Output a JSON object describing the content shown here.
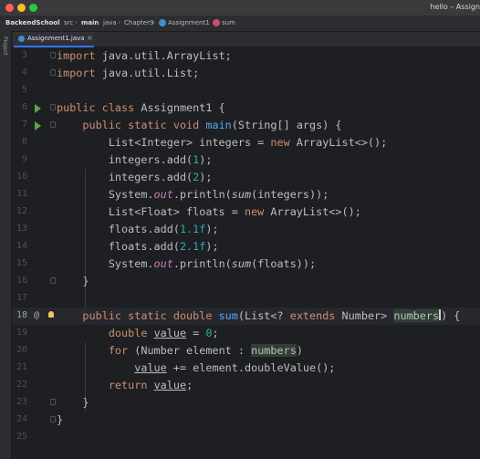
{
  "window": {
    "title": "hello – Assign"
  },
  "breadcrumb": [
    "BackendSchool",
    "src",
    "main",
    "java",
    "Chapter9",
    "Assignment1",
    "sum"
  ],
  "tab": {
    "label": "Assignment1.java",
    "close": "×"
  },
  "side_strip": {
    "label": "Project"
  },
  "editor": {
    "current_line": 18,
    "lines": [
      {
        "n": "3",
        "text": "import java.util.ArrayList;"
      },
      {
        "n": "4",
        "text": "import java.util.List;"
      },
      {
        "n": "5",
        "text": ""
      },
      {
        "n": "6",
        "text": "public class Assignment1 {"
      },
      {
        "n": "7",
        "text": "    public static void main(String[] args) {"
      },
      {
        "n": "8",
        "text": "        List<Integer> integers = new ArrayList<>();"
      },
      {
        "n": "9",
        "text": "        integers.add(1);"
      },
      {
        "n": "10",
        "text": "        integers.add(2);"
      },
      {
        "n": "11",
        "text": "        System.out.println(sum(integers));"
      },
      {
        "n": "12",
        "text": "        List<Float> floats = new ArrayList<>();"
      },
      {
        "n": "13",
        "text": "        floats.add(1.1f);"
      },
      {
        "n": "14",
        "text": "        floats.add(2.1f);"
      },
      {
        "n": "15",
        "text": "        System.out.println(sum(floats));"
      },
      {
        "n": "16",
        "text": "    }"
      },
      {
        "n": "17",
        "text": ""
      },
      {
        "n": "18",
        "text": "    public static double sum(List<? extends Number> numbers) {"
      },
      {
        "n": "19",
        "text": "        double value = 0;"
      },
      {
        "n": "20",
        "text": "        for (Number element : numbers)"
      },
      {
        "n": "21",
        "text": "            value += element.doubleValue();"
      },
      {
        "n": "22",
        "text": "        return value;"
      },
      {
        "n": "23",
        "text": "    }"
      },
      {
        "n": "24",
        "text": "}"
      },
      {
        "n": "25",
        "text": ""
      }
    ]
  },
  "gutter": {
    "override_marker": "@"
  }
}
